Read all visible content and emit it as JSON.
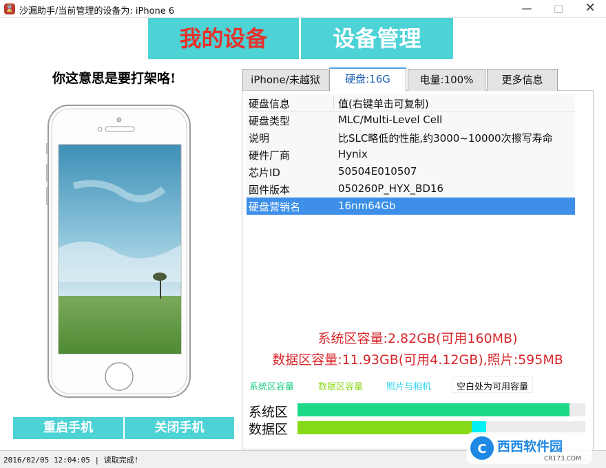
{
  "window": {
    "title": "沙漏助手/当前管理的设备为: iPhone 6",
    "minimize": "—",
    "maximize": "□",
    "close": "✕"
  },
  "nav": {
    "my_device": "我的设备",
    "device_manage": "设备管理"
  },
  "left": {
    "slogan": "你这意思是要打架咯!",
    "restart_button": "重启手机",
    "shutdown_button": "关闭手机"
  },
  "tabs": [
    {
      "label": "iPhone/未越狱"
    },
    {
      "label": "硬盘:16G"
    },
    {
      "label": "电量:100%"
    },
    {
      "label": "更多信息"
    }
  ],
  "disk_table": {
    "header": {
      "key": "硬盘信息",
      "value": "值(右键单击可复制)"
    },
    "rows": [
      {
        "key": "硬盘类型",
        "value": "MLC/Multi-Level Cell"
      },
      {
        "key": "说明",
        "value": "比SLC略低的性能,约3000~10000次擦写寿命"
      },
      {
        "key": "硬件厂商",
        "value": "Hynix"
      },
      {
        "key": "芯片ID",
        "value": "50504E010507"
      },
      {
        "key": "固件版本",
        "value": "050260P_HYX_BD16"
      },
      {
        "key": "硬盘营销名",
        "value": "16nm64Gb"
      }
    ]
  },
  "capacity": {
    "system_line": "系统区容量:2.82GB(可用160MB)",
    "data_line": "数据区容量:11.93GB(可用4.12GB),照片:595MB"
  },
  "legend": {
    "system": "系统区容量",
    "data": "数据区容量",
    "photo": "照片与相机",
    "free": "空白处为可用容量"
  },
  "bars": {
    "system_label": "系统区",
    "data_label": "数据区",
    "system_used_fraction": 0.945,
    "data_used_fraction": 0.605,
    "photo_fraction": 0.05
  },
  "colors": {
    "accent": "#4dd2d6",
    "selected_row": "#3d8fe8",
    "capacity_text": "#d9252a",
    "system_bar": "#1ed988",
    "data_bar": "#86d918",
    "photo_bar": "#00f0f5"
  },
  "status": {
    "text": "2016/02/05 12:04:05 | 读取完成!"
  },
  "watermark": {
    "brand": "西西软件园",
    "site": "CR173.COM"
  }
}
